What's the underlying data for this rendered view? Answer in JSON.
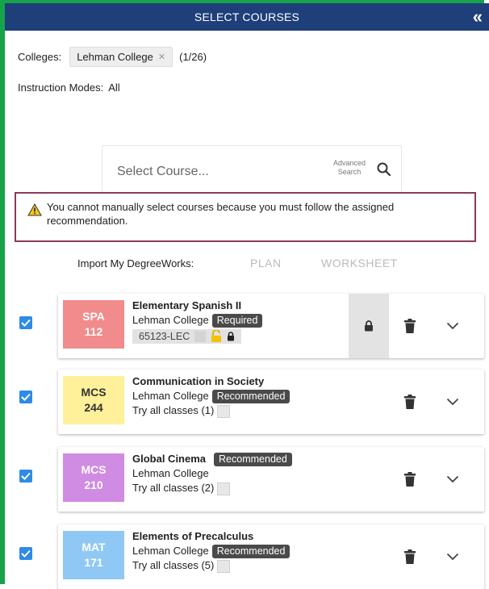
{
  "header": {
    "title": "SELECT COURSES",
    "collapse_label": "«"
  },
  "filters": {
    "colleges_label": "Colleges:",
    "college_chip": "Lehman College",
    "college_count": "(1/26)",
    "modes_label": "Instruction Modes:",
    "modes_value": "All"
  },
  "search": {
    "placeholder": "Select Course...",
    "advanced_line1": "Advanced",
    "advanced_line2": "Search"
  },
  "warning": {
    "message": "You cannot manually select courses because you must follow the assigned recommendation."
  },
  "import": {
    "label": "Import My DegreeWorks:",
    "plan": "PLAN",
    "worksheet": "WORKSHEET"
  },
  "courses": [
    {
      "subject": "SPA",
      "number": "112",
      "title": "Elementary Spanish II",
      "college": "Lehman College",
      "status": "Required",
      "section": "65123-LEC",
      "badge_color": "#f28b8b",
      "badge_text_color": "#ffffff",
      "checked": true,
      "locked": true
    },
    {
      "subject": "MCS",
      "number": "244",
      "title": "Communication in Society",
      "college": "Lehman College",
      "status": "Recommended",
      "classes": "Try all classes (1)",
      "badge_color": "#fff09a",
      "badge_text_color": "#333333",
      "checked": true,
      "locked": false
    },
    {
      "subject": "MCS",
      "number": "210",
      "title": "Global Cinema",
      "college": "Lehman College",
      "status": "Recommended",
      "classes": "Try all classes (2)",
      "badge_color": "#d08be3",
      "badge_text_color": "#ffffff",
      "checked": true,
      "locked": false
    },
    {
      "subject": "MAT",
      "number": "171",
      "title": "Elements of Precalculus",
      "college": "Lehman College",
      "status": "Recommended",
      "classes": "Try all classes (5)",
      "badge_color": "#8fc8f5",
      "badge_text_color": "#ffffff",
      "checked": true,
      "locked": false
    }
  ]
}
